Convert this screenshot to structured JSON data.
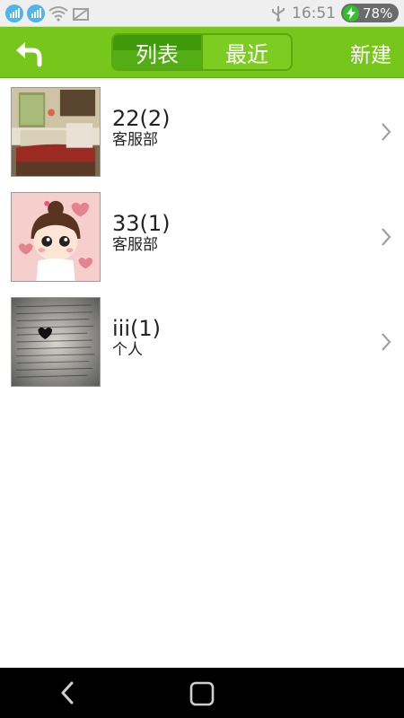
{
  "status_bar": {
    "time": "16:51",
    "battery": "78%",
    "sim1_label": "1",
    "sim2_label": "2",
    "icons": [
      "sim1-icon",
      "sim2-icon",
      "wifi-icon",
      "signal-off-icon",
      "usb-icon",
      "charging-icon"
    ]
  },
  "header": {
    "back_icon": "back-arrow-icon",
    "tabs": [
      {
        "label": "列表",
        "active": true
      },
      {
        "label": "最近",
        "active": false
      }
    ],
    "new_label": "新建",
    "color": "#77c61b"
  },
  "list": {
    "items": [
      {
        "title": "22(2)",
        "subtitle": "客服部",
        "avatar": "room-photo-avatar"
      },
      {
        "title": "33(1)",
        "subtitle": "客服部",
        "avatar": "cartoon-girl-avatar"
      },
      {
        "title": "iii(1)",
        "subtitle": "个人",
        "avatar": "handwriting-avatar"
      }
    ]
  },
  "nav_bar": {
    "icons": [
      "nav-back-icon",
      "nav-home-icon"
    ]
  }
}
